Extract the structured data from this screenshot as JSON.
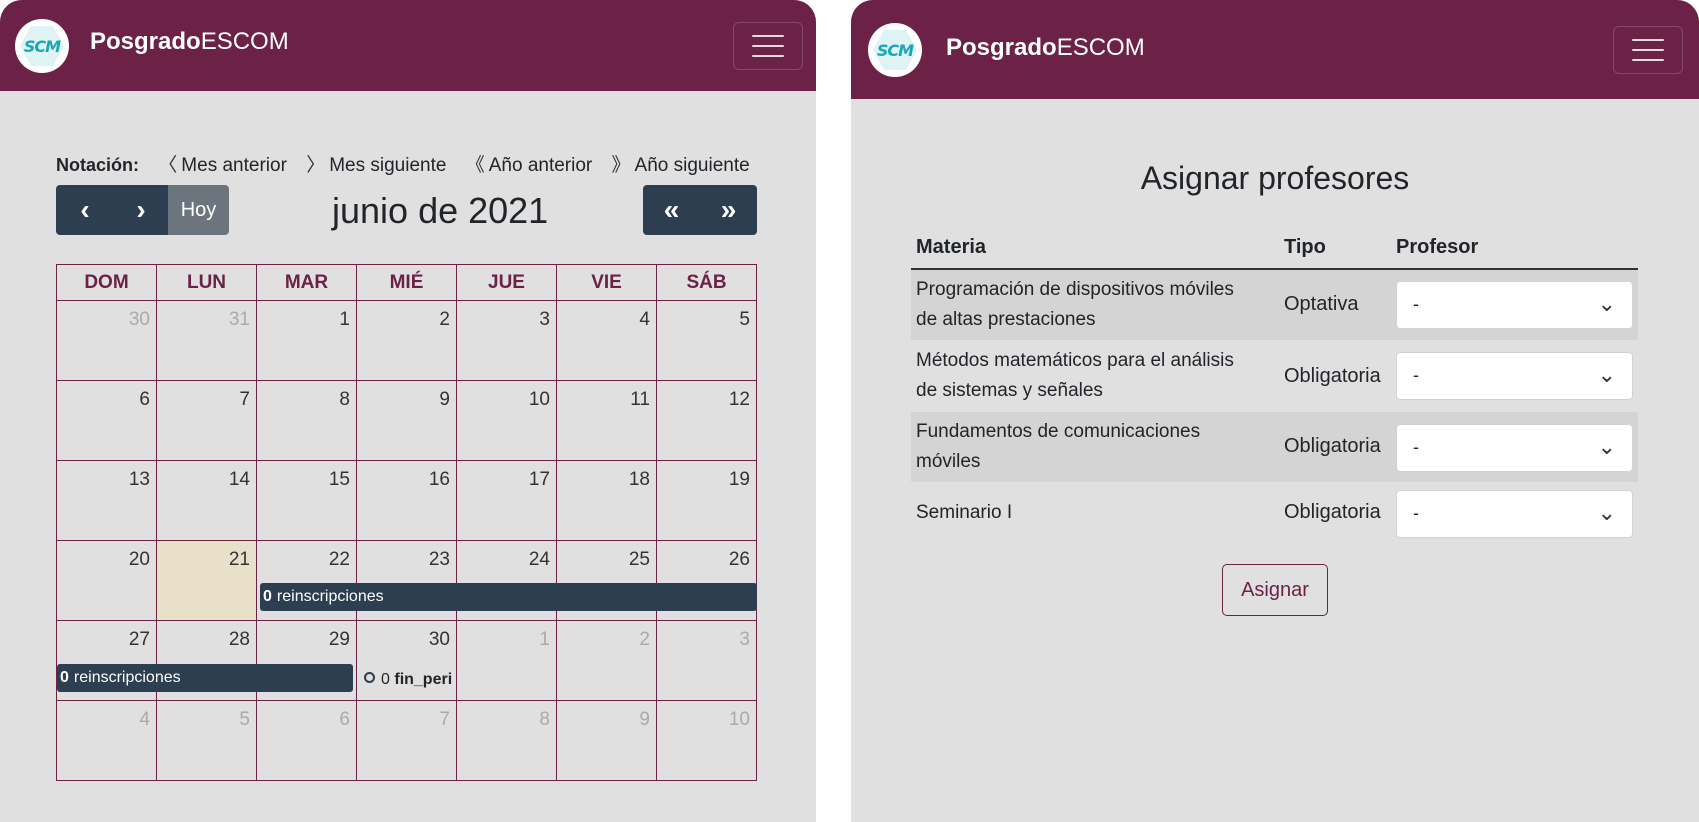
{
  "brand": {
    "bold": "Posgrado",
    "light": "ESCOM",
    "logo_text": "SCM"
  },
  "icons": {
    "menu": "hamburger-icon",
    "prev": "chevron-left-icon",
    "next": "chevron-right-icon",
    "prev_year": "double-chevron-left-icon",
    "next_year": "double-chevron-right-icon",
    "dropdown": "chevron-down-icon"
  },
  "colors": {
    "navbar": "#6b2246",
    "event": "#2c3e50",
    "today": "#e8e0c8",
    "background": "#e0e0e0"
  },
  "calendar": {
    "notation_label": "Notación:",
    "notation": [
      {
        "glyph": "〈",
        "text": "Mes anterior"
      },
      {
        "glyph": "〉",
        "text": "Mes siguiente"
      },
      {
        "glyph": "《",
        "text": "Año anterior"
      },
      {
        "glyph": "》",
        "text": "Año siguiente"
      }
    ],
    "prev_glyph": "‹",
    "next_glyph": "›",
    "today_label": "Hoy",
    "prev_year_glyph": "«",
    "next_year_glyph": "»",
    "title": "junio de 2021",
    "weekdays": [
      "DOM",
      "LUN",
      "MAR",
      "MIÉ",
      "JUE",
      "VIE",
      "SÁB"
    ],
    "weeks": [
      [
        "30",
        "31",
        "1",
        "2",
        "3",
        "4",
        "5"
      ],
      [
        "6",
        "7",
        "8",
        "9",
        "10",
        "11",
        "12"
      ],
      [
        "13",
        "14",
        "15",
        "16",
        "17",
        "18",
        "19"
      ],
      [
        "20",
        "21",
        "22",
        "23",
        "24",
        "25",
        "26"
      ],
      [
        "27",
        "28",
        "29",
        "30",
        "1",
        "2",
        "3"
      ],
      [
        "4",
        "5",
        "6",
        "7",
        "8",
        "9",
        "10"
      ]
    ],
    "today": "21",
    "events": [
      {
        "count": "0",
        "label": "reinscripciones"
      },
      {
        "count": "0",
        "label": "reinscripciones"
      },
      {
        "count": "0",
        "label": "fin_peri"
      }
    ]
  },
  "assign": {
    "title": "Asignar profesores",
    "headers": {
      "materia": "Materia",
      "tipo": "Tipo",
      "profesor": "Profesor"
    },
    "rows": [
      {
        "materia_1": "Programación de dispositivos móviles",
        "materia_2": "de altas prestaciones",
        "tipo": "Optativa",
        "profesor": "-"
      },
      {
        "materia_1": "Métodos matemáticos para el análisis",
        "materia_2": "de sistemas y señales",
        "tipo": "Obligatoria",
        "profesor": "-"
      },
      {
        "materia_1": "Fundamentos de comunicaciones",
        "materia_2": "móviles",
        "tipo": "Obligatoria",
        "profesor": "-"
      },
      {
        "materia_1": "Seminario I",
        "materia_2": "",
        "tipo": "Obligatoria",
        "profesor": "-"
      }
    ],
    "button": "Asignar"
  }
}
